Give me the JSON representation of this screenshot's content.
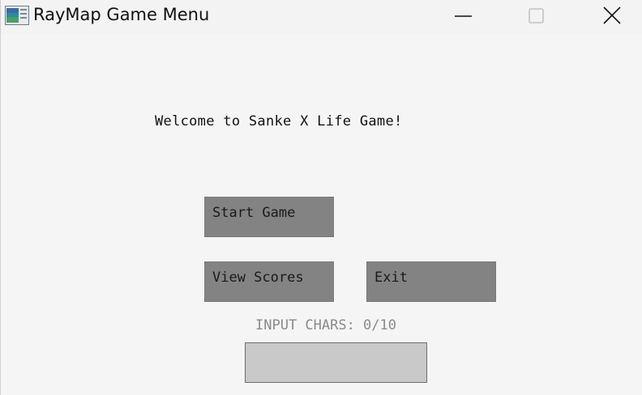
{
  "window": {
    "title": "RayMap Game Menu",
    "icon": "app-window-icon",
    "controls": {
      "minimize_icon": "minimize-icon",
      "maximize_icon": "maximize-icon",
      "close_icon": "close-icon"
    }
  },
  "menu": {
    "welcome_text": "Welcome to Sanke X Life Game!",
    "start_label": "Start Game",
    "scores_label": "View Scores",
    "exit_label": "Exit",
    "input_counter": "INPUT CHARS: 0/10",
    "input_value": ""
  },
  "colors": {
    "background": "#f5f5f5",
    "button_fill": "#838383",
    "input_fill": "#c9c9c9",
    "counter_text": "#8a8a8a"
  }
}
